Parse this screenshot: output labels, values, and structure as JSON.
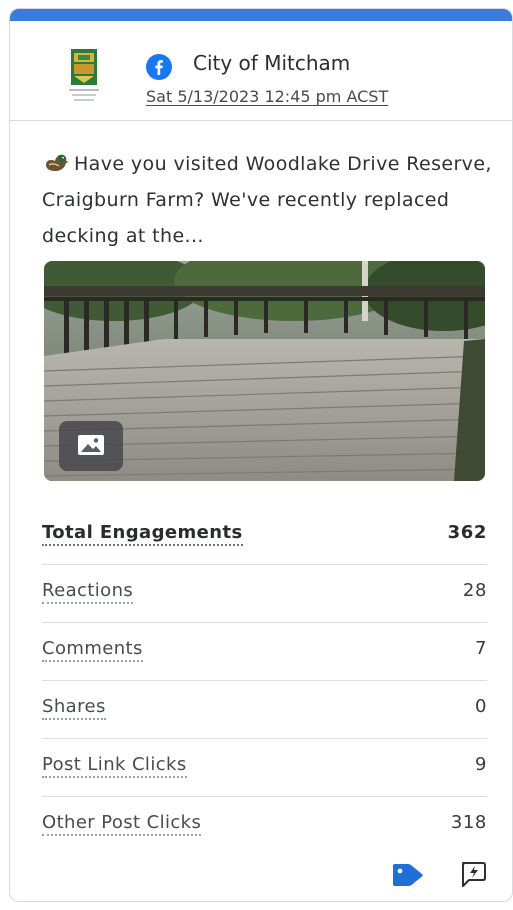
{
  "post": {
    "network_icon": "facebook-icon",
    "account_name": "City of Mitcham",
    "timestamp": "Sat 5/13/2023 12:45 pm ACST",
    "message": "Have you visited Woodlake Drive Reserve, Craigburn Farm? We've recently replaced decking at the...",
    "message_emoji": "duck-icon",
    "has_image": true,
    "image_badge_icon": "image-icon"
  },
  "metrics": [
    {
      "label": "Total Engagements",
      "value": "362"
    },
    {
      "label": "Reactions",
      "value": "28"
    },
    {
      "label": "Comments",
      "value": "7"
    },
    {
      "label": "Shares",
      "value": "0"
    },
    {
      "label": "Post Link Clicks",
      "value": "9"
    },
    {
      "label": "Other Post Clicks",
      "value": "318"
    }
  ],
  "footer": {
    "icons": [
      "tag-icon",
      "quick-reply-icon"
    ]
  },
  "colors": {
    "accent_bar": "#3c7bdc",
    "facebook_blue": "#1877f2",
    "tag_blue": "#1f6fd6"
  }
}
